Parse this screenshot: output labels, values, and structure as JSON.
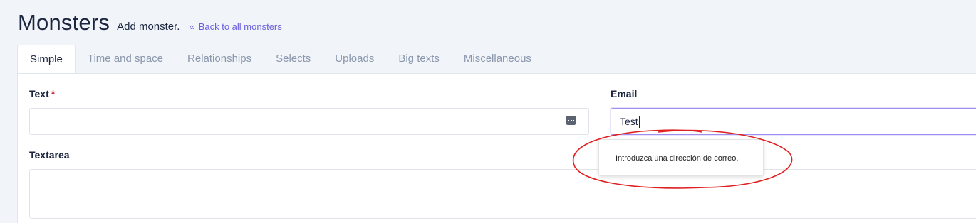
{
  "header": {
    "title": "Monsters",
    "subtitle": "Add monster.",
    "back_link": "Back to all monsters"
  },
  "tabs": [
    {
      "label": "Simple",
      "active": true
    },
    {
      "label": "Time and space"
    },
    {
      "label": "Relationships"
    },
    {
      "label": "Selects"
    },
    {
      "label": "Uploads"
    },
    {
      "label": "Big texts"
    },
    {
      "label": "Miscellaneous"
    }
  ],
  "form": {
    "text": {
      "label": "Text",
      "required_mark": "*",
      "value": ""
    },
    "email": {
      "label": "Email",
      "value": "Test"
    },
    "textarea": {
      "label": "Textarea",
      "value": ""
    }
  },
  "validation_tooltip": "Introduzca una dirección de correo.",
  "colors": {
    "accent": "#6a5fe0",
    "required": "#d0293b",
    "annotation": "#e02020",
    "background": "#f1f4f8"
  },
  "icons": {
    "back": "double-chevron-left-icon",
    "text_field": "keyboard-icon"
  }
}
